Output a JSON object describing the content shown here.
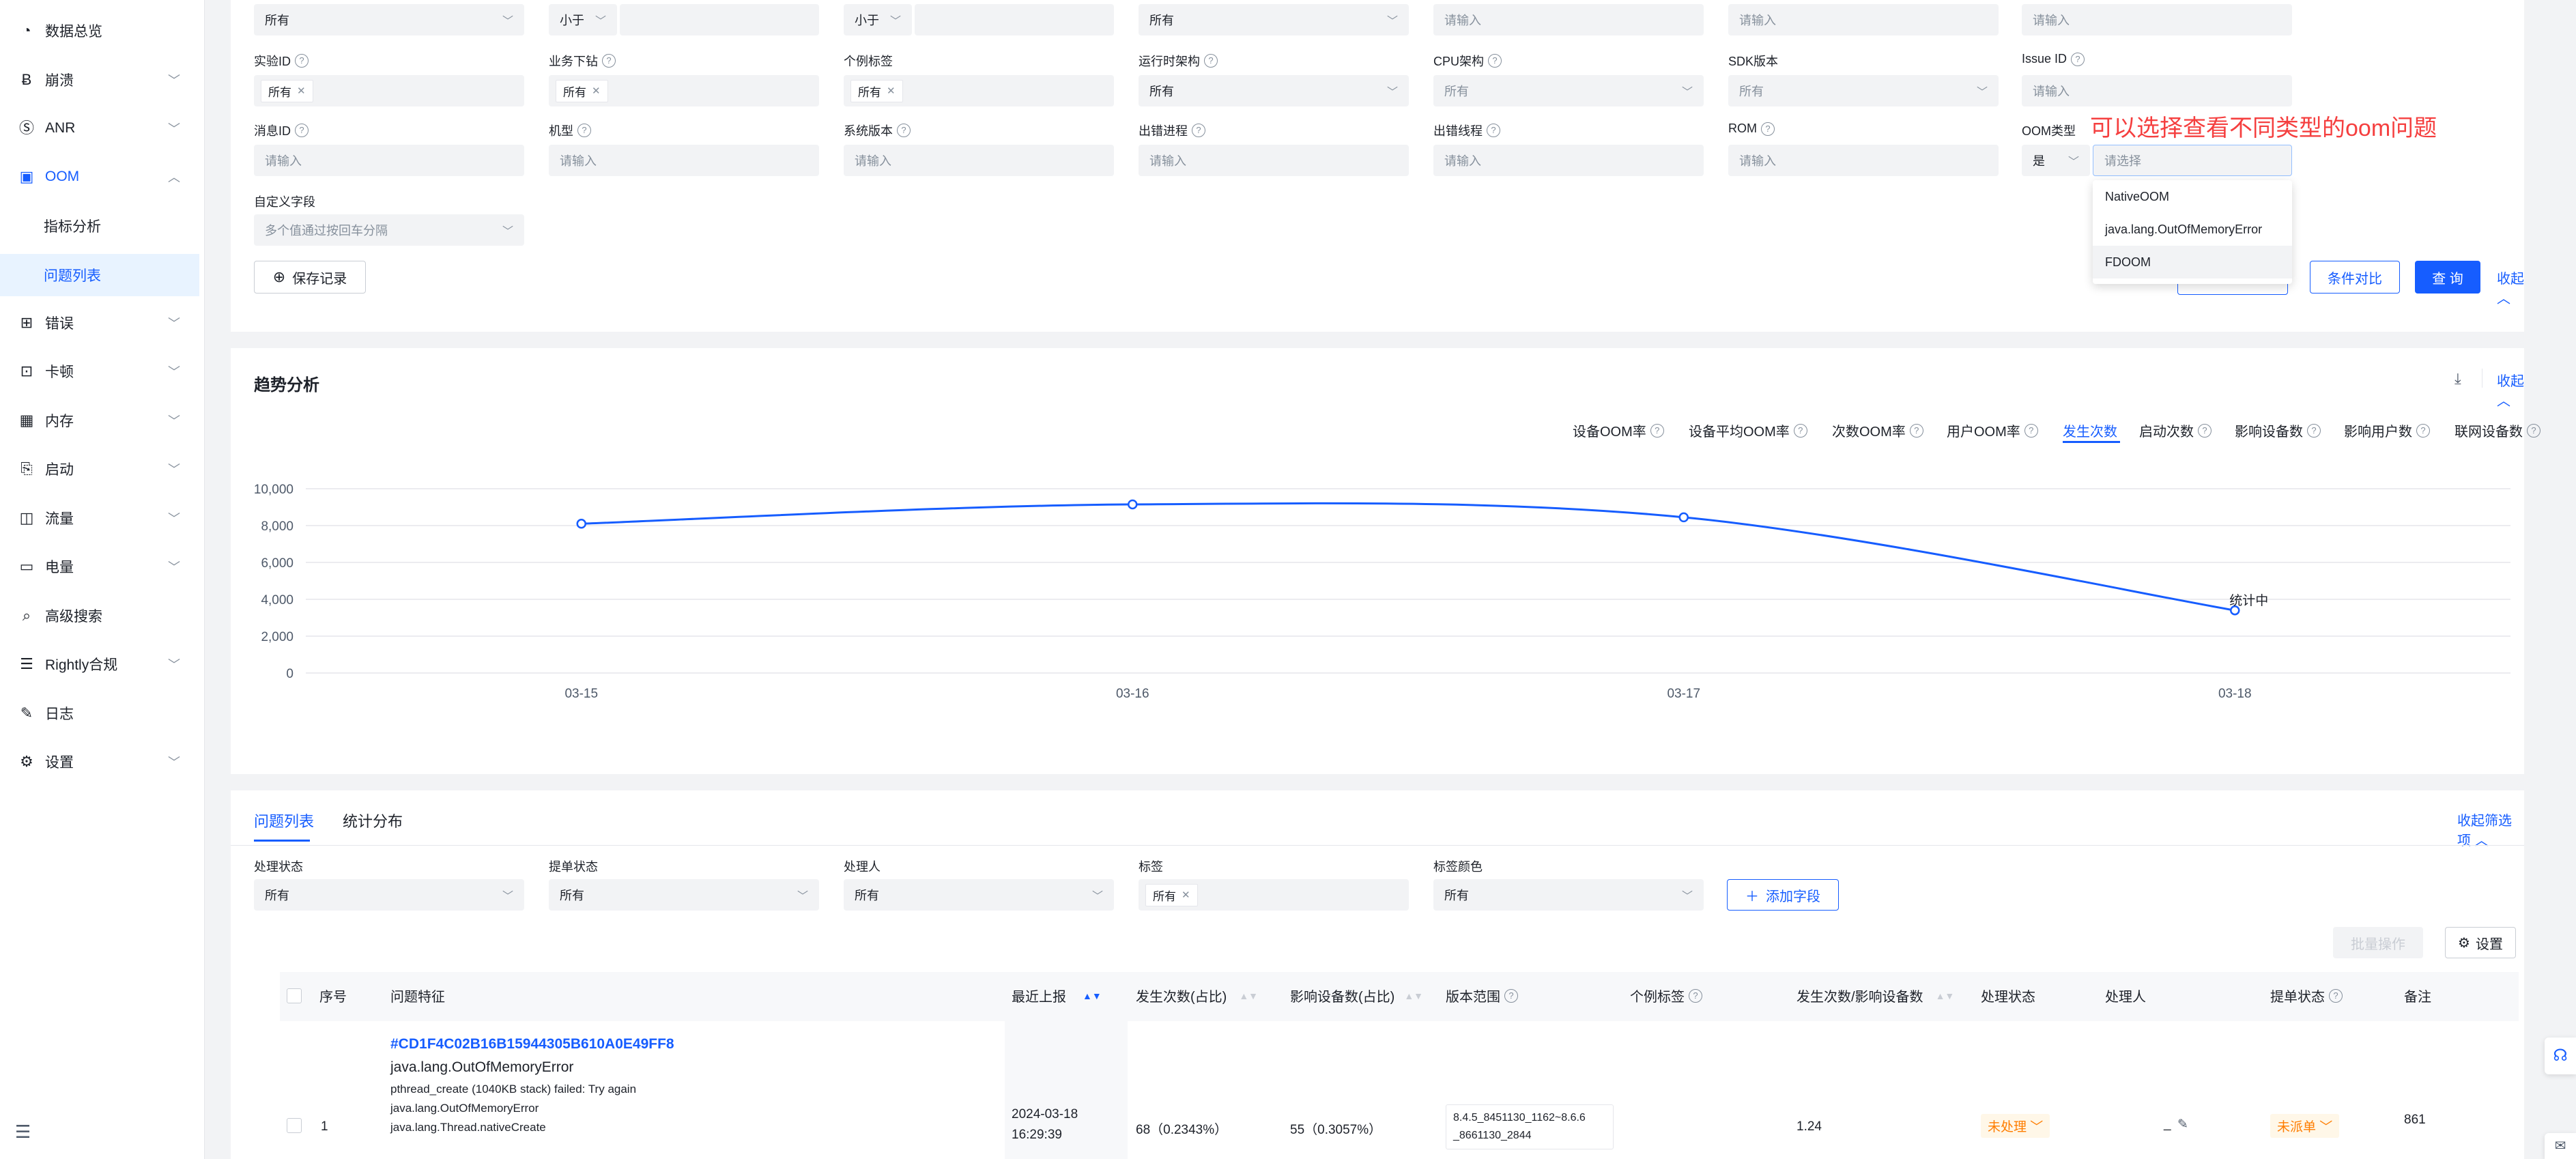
{
  "sidebar": {
    "items": [
      {
        "label": "数据总览",
        "icon": "dashboard-icon"
      },
      {
        "label": "崩溃",
        "icon": "crash-icon"
      },
      {
        "label": "ANR",
        "icon": "anr-icon"
      },
      {
        "label": "OOM",
        "icon": "oom-icon"
      },
      {
        "label": "错误",
        "icon": "error-icon"
      },
      {
        "label": "卡顿",
        "icon": "lag-icon"
      },
      {
        "label": "内存",
        "icon": "memory-icon"
      },
      {
        "label": "启动",
        "icon": "launch-icon"
      },
      {
        "label": "流量",
        "icon": "traffic-icon"
      },
      {
        "label": "电量",
        "icon": "battery-icon"
      },
      {
        "label": "高级搜索",
        "icon": "search-icon"
      },
      {
        "label": "Rightly合规",
        "icon": "compliance-icon"
      },
      {
        "label": "日志",
        "icon": "log-icon"
      },
      {
        "label": "设置",
        "icon": "settings-icon"
      }
    ],
    "oom_sub": [
      "指标分析",
      "问题列表"
    ]
  },
  "filters": {
    "row0": {
      "v1": "所有",
      "op2": "小于",
      "op3": "小于",
      "v4": "所有",
      "ph5": "请输入",
      "ph6": "请输入",
      "ph7": "请输入"
    },
    "labels_row1": [
      "实验ID",
      "业务下钻",
      "个例标签",
      "运行时架构",
      "CPU架构",
      "SDK版本",
      "Issue ID"
    ],
    "row1": {
      "tag1": "所有",
      "tag2": "所有",
      "tag3": "所有",
      "v4": "所有",
      "v5": "所有",
      "v6": "所有",
      "ph7": "请输入"
    },
    "labels_row2": [
      "消息ID",
      "机型",
      "系统版本",
      "出错进程",
      "出错线程",
      "ROM",
      "OOM类型"
    ],
    "row2": {
      "ph": "请输入",
      "oom_yes": "是",
      "oom_select_ph": "请选择"
    },
    "custom_label": "自定义字段",
    "custom_ph": "多个值通过按回车分隔",
    "save_label": "保存记录",
    "compare_label": "条件对比",
    "query_label": "查 询",
    "collapse_label": "收起"
  },
  "oom_dropdown": {
    "options": [
      "NativeOOM",
      "java.lang.OutOfMemoryError",
      "FDOOM"
    ],
    "annotation": "可以选择查看不同类型的oom问题"
  },
  "trend": {
    "title": "趋势分析",
    "collapse_label": "收起",
    "metrics": [
      "设备OOM率",
      "设备平均OOM率",
      "次数OOM率",
      "用户OOM率",
      "发生次数",
      "启动次数",
      "影响设备数",
      "影响用户数",
      "联网设备数"
    ],
    "active_metric": "发生次数",
    "point_label": "统计中"
  },
  "chart_data": {
    "type": "line",
    "x": [
      "03-15",
      "03-16",
      "03-17",
      "03-18"
    ],
    "series": [
      {
        "values": [
          8100,
          9150,
          8450,
          3400
        ]
      }
    ],
    "ylim": [
      0,
      10000
    ],
    "yticks": [
      "0",
      "2,000",
      "4,000",
      "6,000",
      "8,000",
      "10,000"
    ],
    "grid": true,
    "colors": {
      "line": "#165dff"
    }
  },
  "issues": {
    "tabs": [
      "问题列表",
      "统计分布"
    ],
    "collapse_filter_label": "收起筛选项",
    "filter_labels": [
      "处理状态",
      "提单状态",
      "处理人",
      "标签",
      "标签颜色"
    ],
    "filter_values": [
      "所有",
      "所有",
      "所有",
      "所有",
      "所有"
    ],
    "add_field_label": "添加字段",
    "batch_label": "批量操作",
    "settings_label": "设置",
    "columns": [
      "序号",
      "问题特征",
      "最近上报",
      "发生次数(占比)",
      "影响设备数(占比)",
      "版本范围",
      "个例标签",
      "发生次数/影响设备数",
      "处理状态",
      "处理人",
      "提单状态",
      "备注"
    ],
    "rows": [
      {
        "index": "1",
        "id": "#CD1F4C02B16B15944305B610A0E49FF8",
        "title": "java.lang.OutOfMemoryError",
        "lines": [
          "pthread_create (1040KB stack) failed: Try again",
          "java.lang.OutOfMemoryError",
          "java.lang.Thread.nativeCreate"
        ],
        "last_report_date": "2024-03-18",
        "last_report_time": "16:29:39",
        "occurrences": "68（0.2343%）",
        "devices": "55（0.3057%）",
        "version_line1": "8.4.5_8451130_1162~8.6.6",
        "version_line2": "_8661130_2844",
        "ratio": "1.24",
        "status": "未处理",
        "handler": "_",
        "ticket": "未派单",
        "remark": "861"
      }
    ]
  }
}
